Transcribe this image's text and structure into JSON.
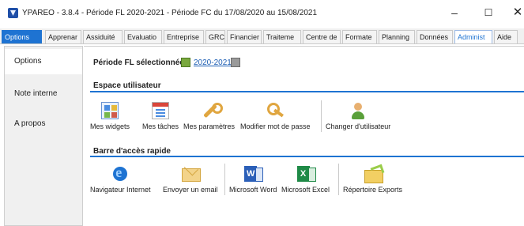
{
  "window": {
    "title": "YPAREO - 3.8.4 - Période FL 2020-2021 - Période FC du 17/08/2020 au 15/08/2021",
    "minimize": "–",
    "maximize": "☐",
    "close": "✕"
  },
  "tabs": [
    {
      "label": "Options",
      "state": "active-blue"
    },
    {
      "label": "Apprenar",
      "state": ""
    },
    {
      "label": "Assiduité",
      "state": ""
    },
    {
      "label": "Evaluatio",
      "state": ""
    },
    {
      "label": "Entreprise",
      "state": ""
    },
    {
      "label": "GRC",
      "state": ""
    },
    {
      "label": "Financier",
      "state": ""
    },
    {
      "label": "Traiteme",
      "state": ""
    },
    {
      "label": "Centre de",
      "state": ""
    },
    {
      "label": "Formate",
      "state": ""
    },
    {
      "label": "Planning",
      "state": ""
    },
    {
      "label": "Données",
      "state": ""
    },
    {
      "label": "Administ",
      "state": "active-white"
    },
    {
      "label": "Aide",
      "state": ""
    }
  ],
  "left_nav": {
    "items": [
      {
        "label": "Options",
        "selected": true
      },
      {
        "label": "Note interne",
        "selected": false
      },
      {
        "label": "A propos",
        "selected": false
      }
    ]
  },
  "main": {
    "period_label": "Période FL sélectionnée :",
    "period_value": "2020-2021",
    "section_user": {
      "title": "Espace utilisateur",
      "tools": [
        {
          "label": "Mes widgets",
          "icon": "widgets-icon"
        },
        {
          "label": "Mes tâches",
          "icon": "tasks-icon"
        },
        {
          "label": "Mes paramètres",
          "icon": "wrench-icon"
        },
        {
          "label": "Modifier mot de passe",
          "icon": "keys-icon"
        },
        {
          "label": "Changer d'utilisateur",
          "icon": "user-icon"
        }
      ]
    },
    "section_quick": {
      "title": "Barre d'accès rapide",
      "tools": [
        {
          "label": "Navigateur Internet",
          "icon": "internet-explorer-icon"
        },
        {
          "label": "Envoyer un email",
          "icon": "envelope-icon"
        },
        {
          "label": "Microsoft Word",
          "icon": "word-icon"
        },
        {
          "label": "Microsoft Excel",
          "icon": "excel-icon"
        },
        {
          "label": "Répertoire Exports",
          "icon": "export-folder-icon"
        }
      ]
    }
  },
  "colors": {
    "accent": "#1e73d2",
    "link": "#1e5fb4"
  }
}
